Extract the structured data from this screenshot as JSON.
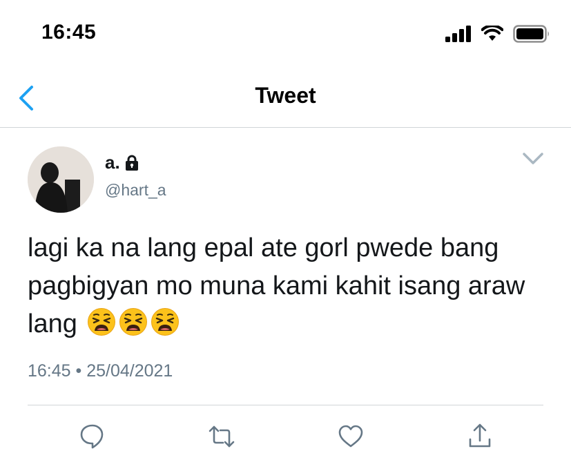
{
  "status_bar": {
    "time": "16:45",
    "icons": [
      "cellular-signal-icon",
      "wifi-icon",
      "battery-icon"
    ]
  },
  "nav": {
    "title": "Tweet",
    "back_icon": "chevron-left-icon"
  },
  "tweet": {
    "display_name": "a.",
    "handle": "@hart_a",
    "protected_icon": "lock-icon",
    "text": "lagi ka na lang epal ate gorl pwede bang pagbigyan mo muna kami kahit isang araw lang",
    "emojis": [
      "weary-face-emoji",
      "weary-face-emoji",
      "weary-face-emoji"
    ],
    "timestamp": "16:45 • 25/04/2021"
  },
  "actions": [
    "reply-icon",
    "retweet-icon",
    "like-icon",
    "share-icon"
  ],
  "colors": {
    "accent": "#1da1f2",
    "secondary_text": "#657786",
    "divider": "#d0d4d8"
  }
}
